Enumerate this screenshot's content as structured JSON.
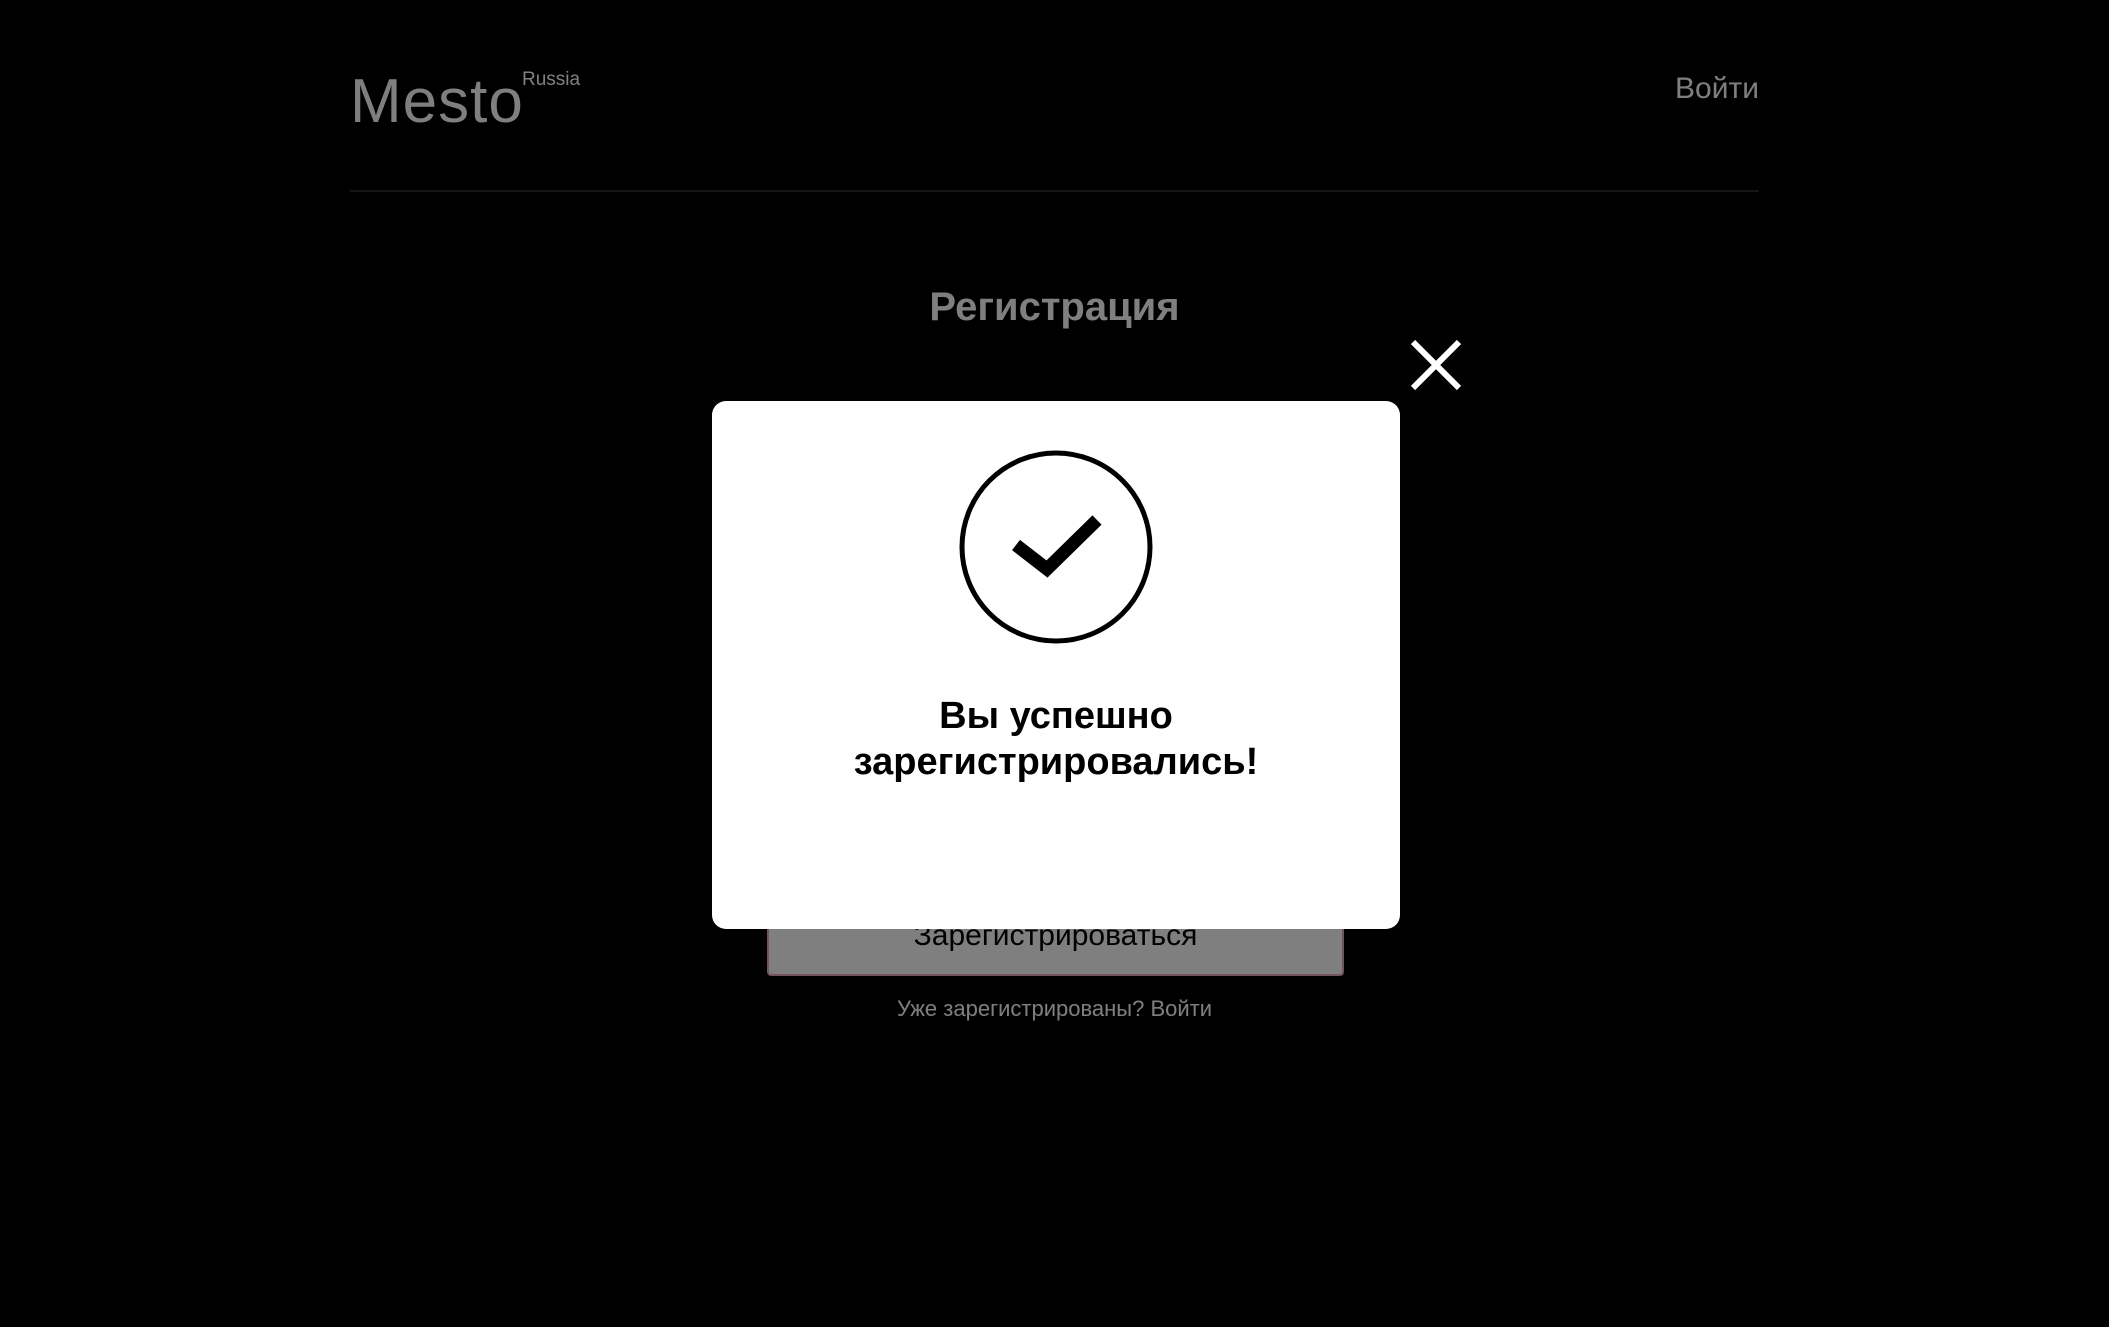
{
  "header": {
    "logo": "Mesto",
    "logo_sub": "Russia",
    "login_link": "Войти"
  },
  "auth": {
    "title": "Регистрация",
    "submit_label": "Зарегистрироваться",
    "hint": "Уже зарегистрированы? Войти"
  },
  "popup": {
    "icon": "check-circle-icon",
    "message_line1": "Вы успешно",
    "message_line2": "зарегистрировались!",
    "close_icon": "close-icon"
  },
  "colors": {
    "background": "#000000",
    "popup_background": "#ffffff",
    "button_border": "#e8a8b6"
  }
}
